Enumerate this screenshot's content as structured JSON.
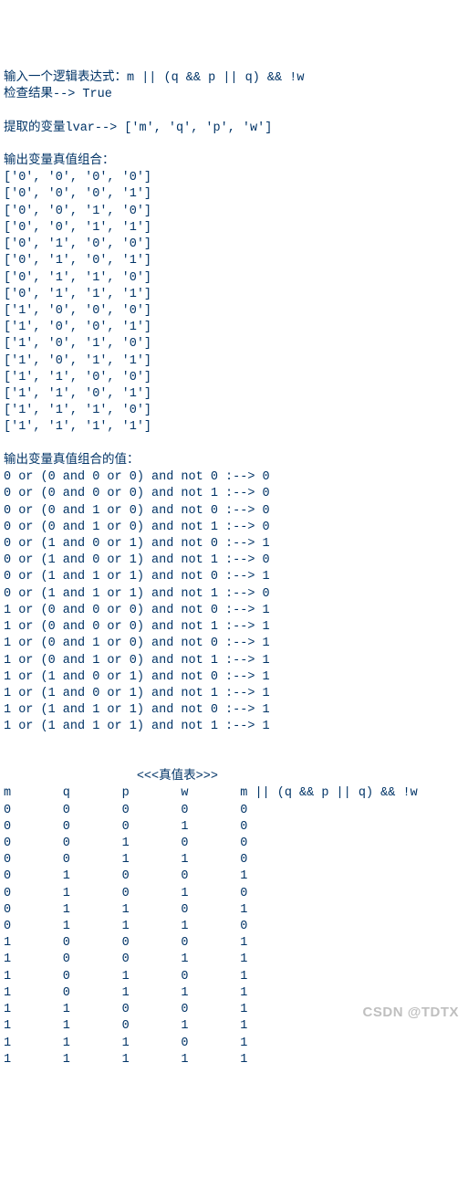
{
  "labels": {
    "prompt_label": "输入一个逻辑表达式：",
    "check_label": "检查结果--> ",
    "lvar_label": "提取的变量lvar--> ",
    "combos_header": "输出变量真值组合：",
    "evals_header": "输出变量真值组合的值：",
    "truthtable_title": "<<<真值表>>>"
  },
  "input": {
    "expression": "m || (q && p || q) && !w",
    "check_result": "True",
    "variables": [
      "m",
      "q",
      "p",
      "w"
    ]
  },
  "truth_combos": [
    [
      "0",
      "0",
      "0",
      "0"
    ],
    [
      "0",
      "0",
      "0",
      "1"
    ],
    [
      "0",
      "0",
      "1",
      "0"
    ],
    [
      "0",
      "0",
      "1",
      "1"
    ],
    [
      "0",
      "1",
      "0",
      "0"
    ],
    [
      "0",
      "1",
      "0",
      "1"
    ],
    [
      "0",
      "1",
      "1",
      "0"
    ],
    [
      "0",
      "1",
      "1",
      "1"
    ],
    [
      "1",
      "0",
      "0",
      "0"
    ],
    [
      "1",
      "0",
      "0",
      "1"
    ],
    [
      "1",
      "0",
      "1",
      "0"
    ],
    [
      "1",
      "0",
      "1",
      "1"
    ],
    [
      "1",
      "1",
      "0",
      "0"
    ],
    [
      "1",
      "1",
      "0",
      "1"
    ],
    [
      "1",
      "1",
      "1",
      "0"
    ],
    [
      "1",
      "1",
      "1",
      "1"
    ]
  ],
  "evaluations": [
    {
      "m": 0,
      "q": 0,
      "p": 0,
      "w": 0,
      "result": 0
    },
    {
      "m": 0,
      "q": 0,
      "p": 0,
      "w": 1,
      "result": 0
    },
    {
      "m": 0,
      "q": 0,
      "p": 1,
      "w": 0,
      "result": 0
    },
    {
      "m": 0,
      "q": 0,
      "p": 1,
      "w": 1,
      "result": 0
    },
    {
      "m": 0,
      "q": 1,
      "p": 0,
      "w": 0,
      "result": 1
    },
    {
      "m": 0,
      "q": 1,
      "p": 0,
      "w": 1,
      "result": 0
    },
    {
      "m": 0,
      "q": 1,
      "p": 1,
      "w": 0,
      "result": 1
    },
    {
      "m": 0,
      "q": 1,
      "p": 1,
      "w": 1,
      "result": 0
    },
    {
      "m": 1,
      "q": 0,
      "p": 0,
      "w": 0,
      "result": 1
    },
    {
      "m": 1,
      "q": 0,
      "p": 0,
      "w": 1,
      "result": 1
    },
    {
      "m": 1,
      "q": 0,
      "p": 1,
      "w": 0,
      "result": 1
    },
    {
      "m": 1,
      "q": 0,
      "p": 1,
      "w": 1,
      "result": 1
    },
    {
      "m": 1,
      "q": 1,
      "p": 0,
      "w": 0,
      "result": 1
    },
    {
      "m": 1,
      "q": 1,
      "p": 0,
      "w": 1,
      "result": 1
    },
    {
      "m": 1,
      "q": 1,
      "p": 1,
      "w": 0,
      "result": 1
    },
    {
      "m": 1,
      "q": 1,
      "p": 1,
      "w": 1,
      "result": 1
    }
  ],
  "watermark": "CSDN @TDTX",
  "chart_data": {
    "type": "table",
    "title": "<<<真值表>>>",
    "columns": [
      "m",
      "q",
      "p",
      "w",
      "m || (q && p || q) && !w"
    ],
    "rows": [
      [
        0,
        0,
        0,
        0,
        0
      ],
      [
        0,
        0,
        0,
        1,
        0
      ],
      [
        0,
        0,
        1,
        0,
        0
      ],
      [
        0,
        0,
        1,
        1,
        0
      ],
      [
        0,
        1,
        0,
        0,
        1
      ],
      [
        0,
        1,
        0,
        1,
        0
      ],
      [
        0,
        1,
        1,
        0,
        1
      ],
      [
        0,
        1,
        1,
        1,
        0
      ],
      [
        1,
        0,
        0,
        0,
        1
      ],
      [
        1,
        0,
        0,
        1,
        1
      ],
      [
        1,
        0,
        1,
        0,
        1
      ],
      [
        1,
        0,
        1,
        1,
        1
      ],
      [
        1,
        1,
        0,
        0,
        1
      ],
      [
        1,
        1,
        0,
        1,
        1
      ],
      [
        1,
        1,
        1,
        0,
        1
      ],
      [
        1,
        1,
        1,
        1,
        1
      ]
    ]
  }
}
